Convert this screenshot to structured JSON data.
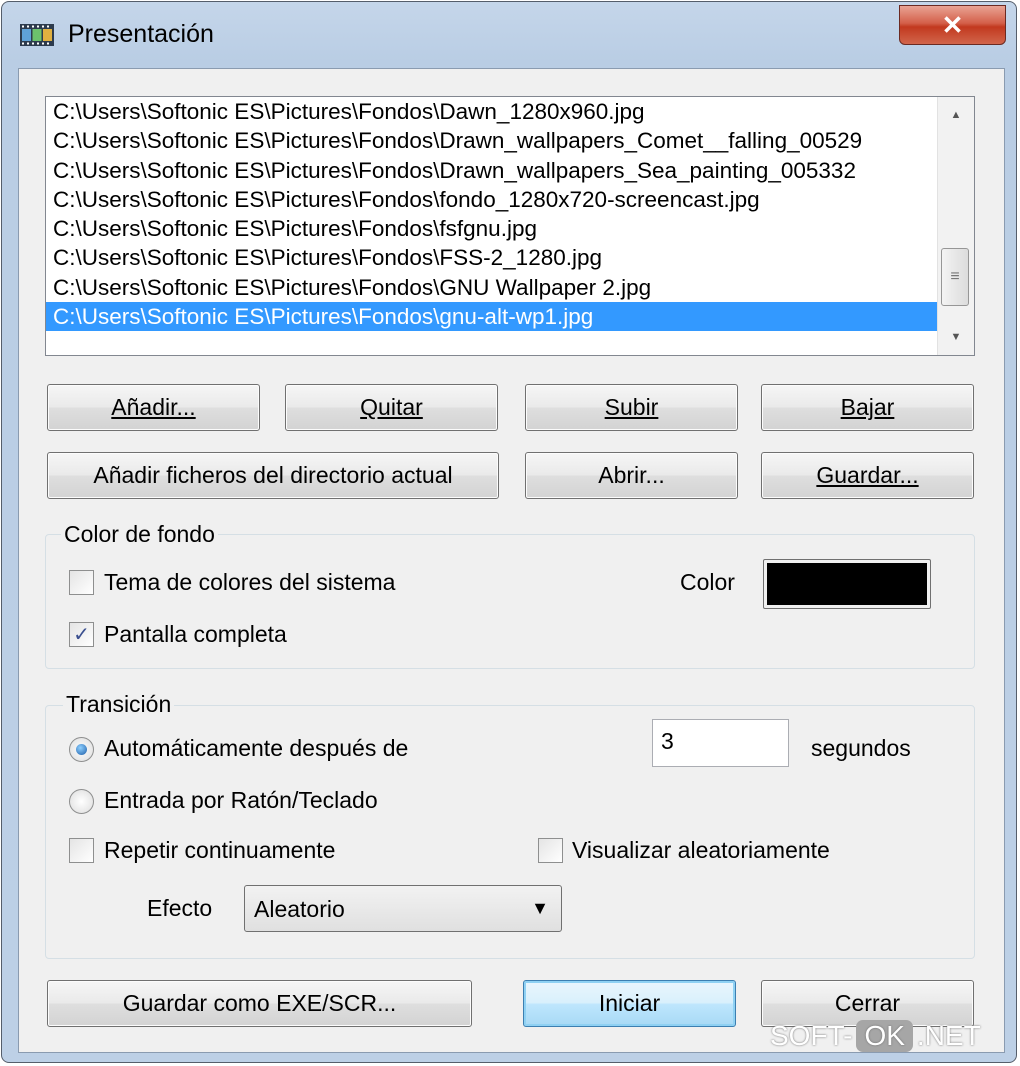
{
  "window": {
    "title": "Presentación",
    "close_glyph": "✕",
    "icon": "slideshow-app-icon"
  },
  "file_list": {
    "items": [
      "C:\\Users\\Softonic ES\\Pictures\\Fondos\\Dawn_1280x960.jpg",
      "C:\\Users\\Softonic ES\\Pictures\\Fondos\\Drawn_wallpapers_Comet__falling_00529",
      "C:\\Users\\Softonic ES\\Pictures\\Fondos\\Drawn_wallpapers_Sea_painting_005332",
      "C:\\Users\\Softonic ES\\Pictures\\Fondos\\fondo_1280x720-screencast.jpg",
      "C:\\Users\\Softonic ES\\Pictures\\Fondos\\fsfgnu.jpg",
      "C:\\Users\\Softonic ES\\Pictures\\Fondos\\FSS-2_1280.jpg",
      "C:\\Users\\Softonic ES\\Pictures\\Fondos\\GNU Wallpaper 2.jpg",
      "C:\\Users\\Softonic ES\\Pictures\\Fondos\\gnu-alt-wp1.jpg"
    ],
    "selected_index": 7,
    "selection_color": "#3399ff"
  },
  "buttons": {
    "add": "Añadir...",
    "remove": "Quitar",
    "up": "Subir",
    "down": "Bajar",
    "add_dir": "Añadir ficheros del directorio actual",
    "open": "Abrir...",
    "save": "Guardar...",
    "save_exe": "Guardar como EXE/SCR...",
    "start": "Iniciar",
    "close": "Cerrar"
  },
  "background": {
    "group_label": "Color de fondo",
    "system_theme_label": "Tema de colores del sistema",
    "system_theme_checked": false,
    "fullscreen_label": "Pantalla completa",
    "fullscreen_checked": true,
    "color_label": "Color",
    "color_value": "#000000"
  },
  "transition": {
    "group_label": "Transición",
    "auto_label": "Automáticamente después de",
    "auto_selected": true,
    "seconds_value": "3",
    "seconds_label": "segundos",
    "manual_label": "Entrada por Ratón/Teclado",
    "manual_selected": false,
    "repeat_label": "Repetir continuamente",
    "repeat_checked": false,
    "random_label": "Visualizar aleatoriamente",
    "random_checked": false,
    "effect_label": "Efecto",
    "effect_value": "Aleatorio"
  },
  "watermark": {
    "left": "SOFT-",
    "middle": "OK",
    "right": ".NET"
  }
}
